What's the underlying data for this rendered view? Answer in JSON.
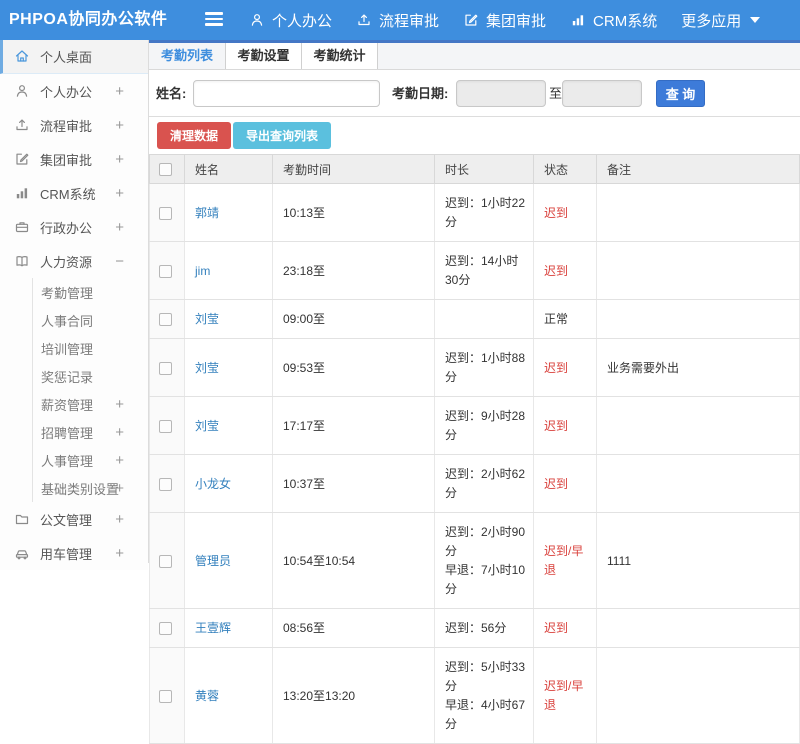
{
  "topbar": {
    "logo": "PHPOA协同办公软件",
    "nav": [
      {
        "label": "个人办公",
        "icon": "person-icon"
      },
      {
        "label": "流程审批",
        "icon": "workflow-icon"
      },
      {
        "label": "集团审批",
        "icon": "edit-icon"
      },
      {
        "label": "CRM系统",
        "icon": "chart-icon"
      },
      {
        "label": "更多应用",
        "icon": "caret-down-icon",
        "icon_position": "after"
      }
    ]
  },
  "sidebar": {
    "items": [
      {
        "label": "个人桌面",
        "icon": "home-icon",
        "active": true
      },
      {
        "label": "个人办公",
        "icon": "person-icon",
        "expand": "+"
      },
      {
        "label": "流程审批",
        "icon": "workflow-icon",
        "expand": "+"
      },
      {
        "label": "集团审批",
        "icon": "edit-icon",
        "expand": "+"
      },
      {
        "label": "CRM系统",
        "icon": "chart-icon",
        "expand": "+"
      },
      {
        "label": "行政办公",
        "icon": "briefcase-icon",
        "expand": "+"
      },
      {
        "label": "人力资源",
        "icon": "book-icon",
        "expand": "−",
        "children": [
          {
            "label": "考勤管理"
          },
          {
            "label": "人事合同"
          },
          {
            "label": "培训管理"
          },
          {
            "label": "奖惩记录"
          },
          {
            "label": "薪资管理",
            "expand": "+"
          },
          {
            "label": "招聘管理",
            "expand": "+"
          },
          {
            "label": "人事管理",
            "expand": "+"
          },
          {
            "label": "基础类别设置",
            "expand": "+"
          }
        ]
      },
      {
        "label": "公文管理",
        "icon": "document-icon",
        "expand": "+"
      },
      {
        "label": "用车管理",
        "icon": "car-icon",
        "expand": "+"
      }
    ]
  },
  "tabs": [
    {
      "label": "考勤列表",
      "active": true
    },
    {
      "label": "考勤设置",
      "active": false
    },
    {
      "label": "考勤统计",
      "active": false
    }
  ],
  "search": {
    "name_label": "姓名:",
    "name_value": "",
    "date_label": "考勤日期:",
    "date_from_value": "",
    "to_label": "至",
    "date_to_value": "",
    "search_button": "查 询"
  },
  "toolbar": {
    "clean_button": "清理数据",
    "export_button": "导出查询列表"
  },
  "table": {
    "columns": [
      "姓名",
      "考勤时间",
      "时长",
      "状态",
      "备注"
    ],
    "rows": [
      {
        "name": "郭靖",
        "time": "10:13至",
        "duration": [
          "迟到：1小时22分"
        ],
        "status": "迟到",
        "status_type": "late",
        "note": ""
      },
      {
        "name": "jim",
        "time": "23:18至",
        "duration": [
          "迟到：14小时30分"
        ],
        "status": "迟到",
        "status_type": "late",
        "note": ""
      },
      {
        "name": "刘莹",
        "time": "09:00至",
        "duration": [],
        "status": "正常",
        "status_type": "normal",
        "note": ""
      },
      {
        "name": "刘莹",
        "time": "09:53至",
        "duration": [
          "迟到：1小时88分"
        ],
        "status": "迟到",
        "status_type": "late",
        "note": "业务需要外出"
      },
      {
        "name": "刘莹",
        "time": "17:17至",
        "duration": [
          "迟到：9小时28分"
        ],
        "status": "迟到",
        "status_type": "late",
        "note": ""
      },
      {
        "name": "小龙女",
        "time": "10:37至",
        "duration": [
          "迟到：2小时62分"
        ],
        "status": "迟到",
        "status_type": "late",
        "note": ""
      },
      {
        "name": "管理员",
        "time": "10:54至10:54",
        "duration": [
          "迟到：2小时90分",
          "早退：7小时10分"
        ],
        "status": "迟到/早退",
        "status_type": "late",
        "note": "1111"
      },
      {
        "name": "王壹辉",
        "time": "08:56至",
        "duration": [
          "迟到：56分"
        ],
        "status": "迟到",
        "status_type": "late",
        "note": ""
      },
      {
        "name": "黄蓉",
        "time": "13:20至13:20",
        "duration": [
          "迟到：5小时33分",
          "早退：4小时67分"
        ],
        "status": "迟到/早退",
        "status_type": "late",
        "note": ""
      }
    ]
  },
  "colors": {
    "topbar_blue": "#3e8ede",
    "tabstrip_top_blue": "#4477c5",
    "search_button_blue": "#3d7bd9",
    "clean_button_red": "#d9534f",
    "export_button_teal": "#5bc0de",
    "status_red": "#d9403b",
    "link_blue": "#3380bd"
  }
}
